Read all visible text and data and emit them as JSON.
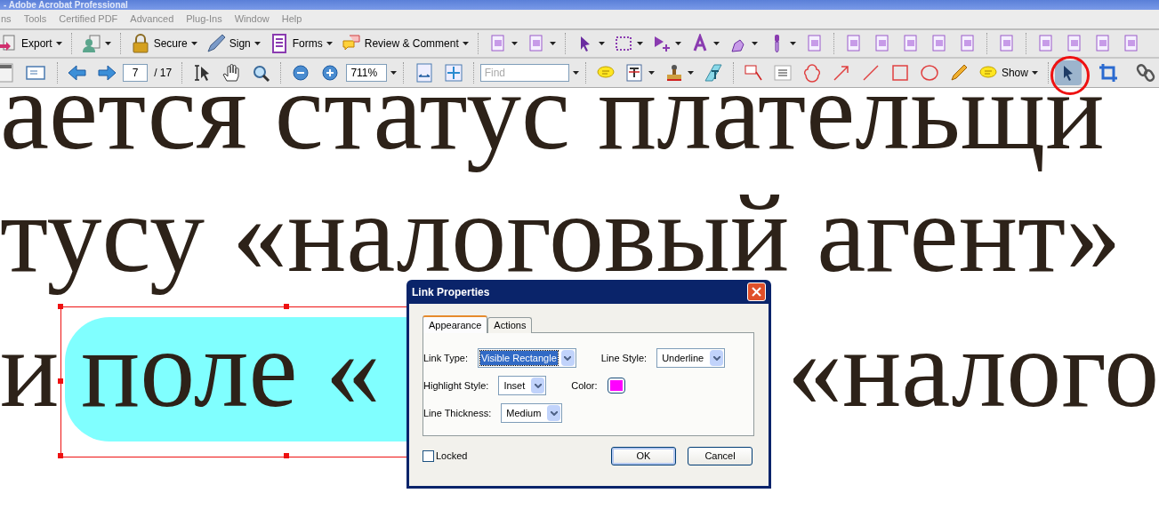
{
  "window": {
    "title": "- Adobe Acrobat Professional"
  },
  "menu": [
    "ns",
    "Tools",
    "Certified PDF",
    "Advanced",
    "Plug-Ins",
    "Window",
    "Help"
  ],
  "toolbar_1": {
    "buttons": [
      "Export",
      "Secure",
      "Sign",
      "Forms",
      "Review & Comment"
    ]
  },
  "toolbar_2": {
    "page": "7",
    "page_total": "/ 17",
    "zoom": "711%",
    "find": {
      "placeholder": "Find"
    },
    "show_button": "Show",
    "object_tool": {
      "selected": true
    }
  },
  "document": {
    "lines": [
      [
        "ается статус плательщи"
      ],
      [
        "тусу",
        "«налоговый агент»"
      ]
    ],
    "link_line": {
      "before": "и",
      "link_text": "поле «",
      "after": "«налого"
    }
  },
  "dialog": {
    "title": "Link Properties",
    "tabs": [
      {
        "label": "Appearance",
        "selected": true
      },
      {
        "label": "Actions",
        "selected": false
      }
    ],
    "link_type": {
      "label": "Link Type:",
      "value": "Visible Rectangle"
    },
    "line_style": {
      "label": "Line Style:",
      "value": "Underline"
    },
    "highlight_style": {
      "label": "Highlight Style:",
      "value": "Inset"
    },
    "color": {
      "label": "Color:",
      "color": "#ff00ff"
    },
    "line_thickness": {
      "label": "Line Thickness:",
      "value": "Medium"
    },
    "locked": {
      "label": "Locked",
      "checked": false
    },
    "buttons": [
      "OK",
      "Cancel"
    ]
  }
}
